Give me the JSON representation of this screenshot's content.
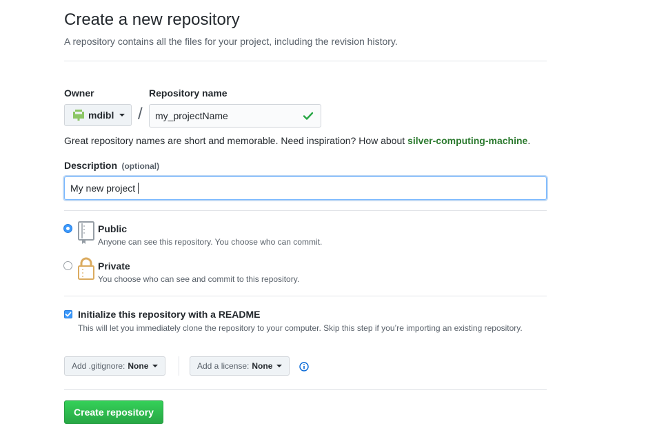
{
  "header": {
    "title": "Create a new repository",
    "subtitle": "A repository contains all the files for your project, including the revision history."
  },
  "owner": {
    "label": "Owner",
    "value": "mdibl"
  },
  "separator": "/",
  "repo_name": {
    "label": "Repository name",
    "value": "my_projectName"
  },
  "hint": {
    "text": "Great repository names are short and memorable. Need inspiration? How about ",
    "suggestion": "silver-computing-machine",
    "end": "."
  },
  "description": {
    "label": "Description",
    "optional": "(optional)",
    "value": "My new project"
  },
  "visibility": {
    "public": {
      "title": "Public",
      "desc": "Anyone can see this repository. You choose who can commit.",
      "selected": true
    },
    "private": {
      "title": "Private",
      "desc": "You choose who can see and commit to this repository.",
      "selected": false
    }
  },
  "readme": {
    "title": "Initialize this repository with a README",
    "desc": "This will let you immediately clone the repository to your computer. Skip this step if you’re importing an existing repository.",
    "checked": true
  },
  "gitignore": {
    "label": "Add .gitignore:",
    "value": "None"
  },
  "license": {
    "label": "Add a license:",
    "value": "None"
  },
  "submit": {
    "label": "Create repository"
  },
  "colors": {
    "accent_green": "#28a745",
    "suggestion_green": "#2c7a2f",
    "radio_blue": "#3b99fc",
    "info_blue": "#0366d6"
  },
  "icons": [
    "identicon",
    "caret-down-icon",
    "check-icon",
    "repo-icon",
    "lock-icon",
    "checkmark-icon",
    "info-icon"
  ]
}
